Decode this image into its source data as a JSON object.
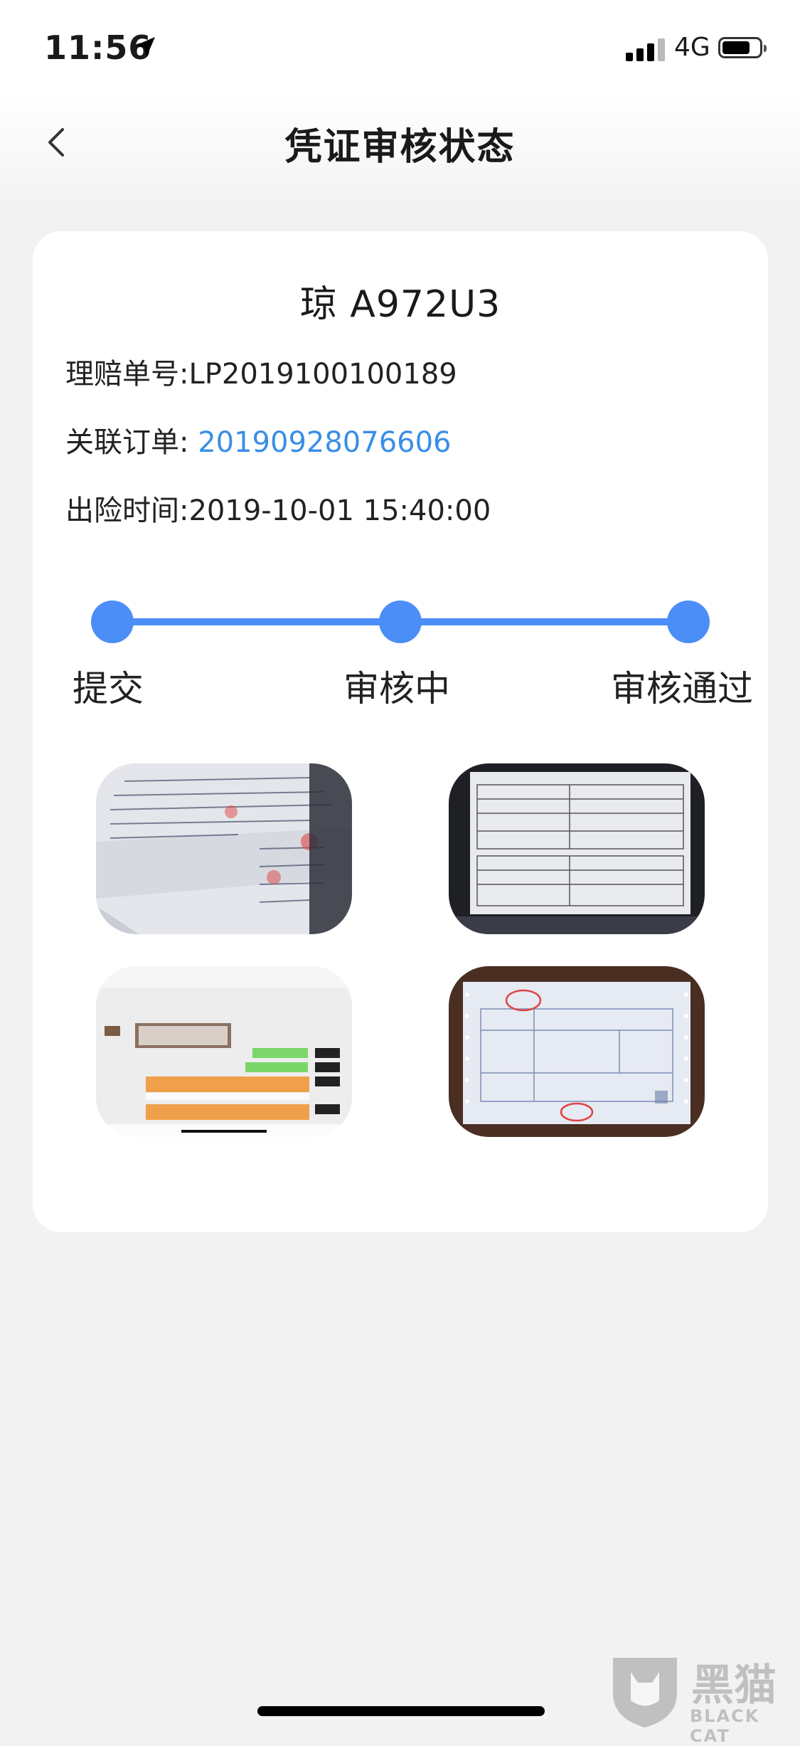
{
  "status_bar": {
    "time": "11:56",
    "network": "4G"
  },
  "nav": {
    "title": "凭证审核状态"
  },
  "claim": {
    "plate": "琼 A972U3",
    "claim_no_label": "理赔单号:",
    "claim_no": "LP2019100100189",
    "order_label": "关联订单:",
    "order_no": "20190928076606",
    "accident_time_label": "出险时间:",
    "accident_time": "2019-10-01 15:40:00"
  },
  "progress": {
    "steps": [
      {
        "label": "提交"
      },
      {
        "label": "审核中"
      },
      {
        "label": "审核通过"
      }
    ],
    "accent": "#4c8ef7"
  },
  "attachments": [
    {
      "icon": "handwritten-letter-photo"
    },
    {
      "icon": "form-document-photo"
    },
    {
      "icon": "chat-screenshot-photo"
    },
    {
      "icon": "invoice-photo"
    }
  ],
  "watermark": {
    "cn": "黑猫",
    "en": "BLACK CAT"
  }
}
